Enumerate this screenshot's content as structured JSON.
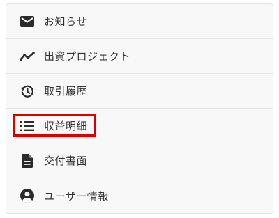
{
  "menu": {
    "items": [
      {
        "label": "お知らせ",
        "icon": "envelope-icon"
      },
      {
        "label": "出資プロジェクト",
        "icon": "trending-line-icon"
      },
      {
        "label": "取引履歴",
        "icon": "history-icon"
      },
      {
        "label": "収益明細",
        "icon": "list-icon",
        "highlighted": true
      },
      {
        "label": "交付書面",
        "icon": "document-icon"
      },
      {
        "label": "ユーザー情報",
        "icon": "user-circle-icon"
      }
    ]
  },
  "colors": {
    "icon": "#2b2b2b",
    "text": "#333333",
    "menu_background": "#f8f8f8",
    "highlight": "#d90000"
  }
}
